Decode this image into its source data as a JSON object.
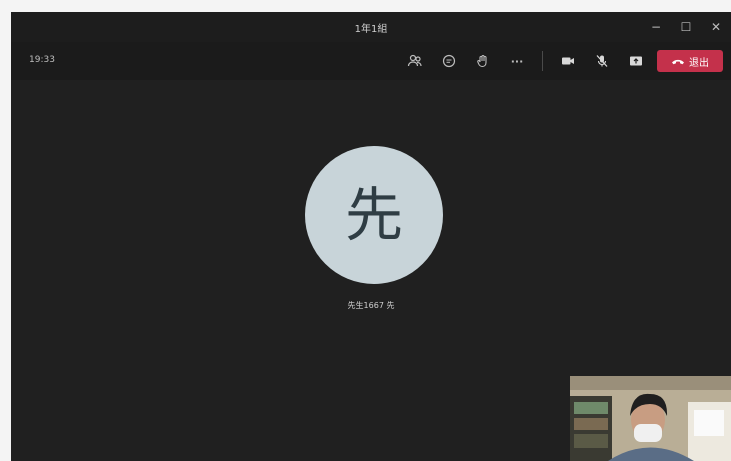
{
  "window": {
    "title": "1年1組",
    "controls": {
      "minimize": "−",
      "maximize": "☐",
      "close": "✕"
    }
  },
  "call": {
    "elapsed_time": "19:33",
    "toolbar": {
      "icons": [
        "participants-icon",
        "chat-icon",
        "raise-hand-icon",
        "more-options-icon",
        "camera-icon",
        "mic-off-icon",
        "share-icon"
      ],
      "more_label": "···",
      "leave_label": "退出",
      "leave_color": "#c4314b"
    }
  },
  "stage": {
    "avatar_initial": "先",
    "avatar_bg": "#c8d4d9",
    "participant_name": "先生1667 先"
  },
  "colors": {
    "app_bg": "#202020",
    "titlebar_bg": "#1d1d1d"
  }
}
